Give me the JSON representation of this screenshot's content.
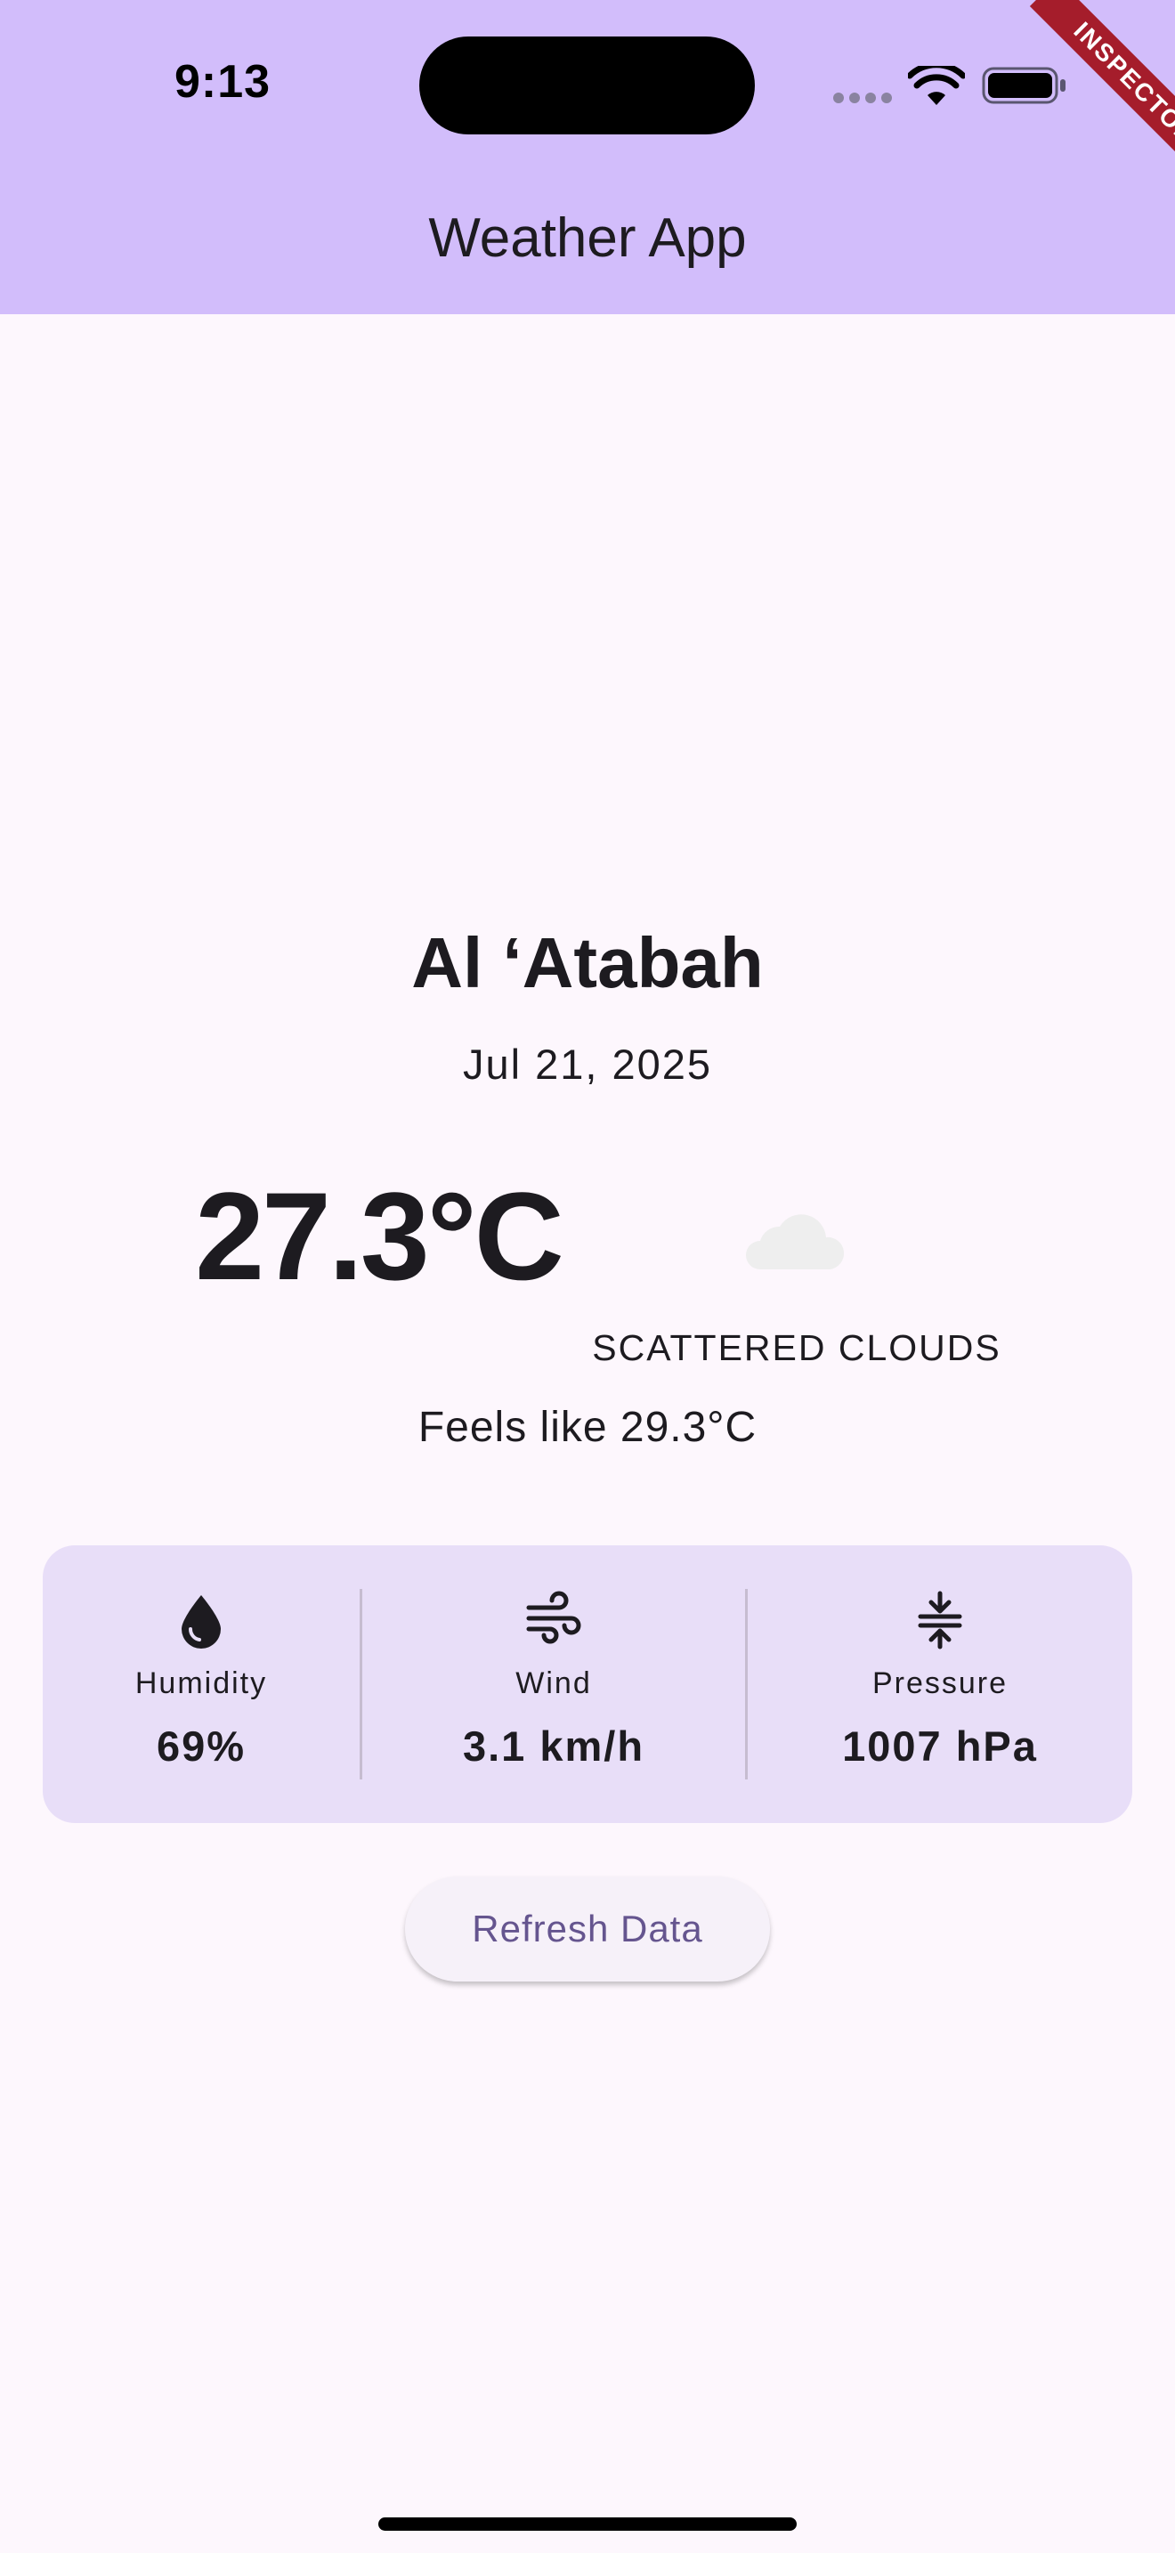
{
  "status_bar": {
    "time": "9:13",
    "icons": [
      "cellular-signal-icon",
      "wifi-icon",
      "battery-icon"
    ]
  },
  "debug_banner": {
    "label": "INSPECTOR"
  },
  "app_bar": {
    "title": "Weather App"
  },
  "weather": {
    "city": "Al ‘Atabah",
    "date": "Jul 21, 2025",
    "temperature": "27.3°C",
    "icon": "cloud-icon",
    "condition": "SCATTERED CLOUDS",
    "feels_like": "Feels like 29.3°C"
  },
  "stats": [
    {
      "icon": "water-drop-icon",
      "label": "Humidity",
      "value": "69%"
    },
    {
      "icon": "wind-icon",
      "label": "Wind",
      "value": "3.1 km/h"
    },
    {
      "icon": "pressure-icon",
      "label": "Pressure",
      "value": "1007 hPa"
    }
  ],
  "actions": {
    "refresh_label": "Refresh Data"
  },
  "colors": {
    "app_bar_background": "#d2bdfb",
    "page_background": "#fdf7fd",
    "card_background": "#e8def8",
    "button_text": "#65558f",
    "text_primary": "#1d1b20",
    "banner": "#a51d2b"
  }
}
